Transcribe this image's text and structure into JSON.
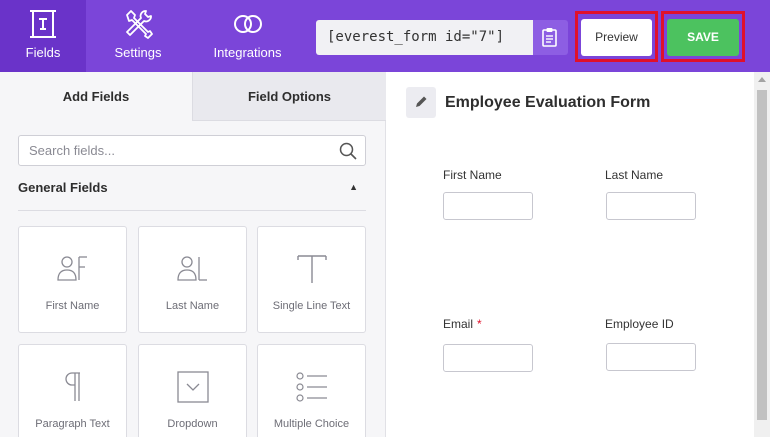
{
  "topnav": {
    "fields": {
      "label": "Fields",
      "icon": "form-fields-icon"
    },
    "settings": {
      "label": "Settings",
      "icon": "tools-icon"
    },
    "integrations": {
      "label": "Integrations",
      "icon": "rings-icon"
    }
  },
  "shortcode": "[everest_form id=\"7\"]",
  "copy_icon": "clipboard-icon",
  "actions": {
    "preview": "Preview",
    "save": "SAVE"
  },
  "colors": {
    "topbar": "#7b45d9",
    "active_nav": "#6a33c9",
    "save": "#4cc25f",
    "highlight": "#e0102b"
  },
  "left": {
    "tabs": [
      "Add Fields",
      "Field Options"
    ],
    "search_placeholder": "Search fields...",
    "section_title": "General Fields",
    "fields": [
      {
        "label": "First Name",
        "icon": "first-name-icon"
      },
      {
        "label": "Last Name",
        "icon": "last-name-icon"
      },
      {
        "label": "Single Line Text",
        "icon": "text-icon"
      },
      {
        "label": "Paragraph Text",
        "icon": "paragraph-icon"
      },
      {
        "label": "Dropdown",
        "icon": "dropdown-icon"
      },
      {
        "label": "Multiple Choice",
        "icon": "multiple-choice-icon"
      }
    ]
  },
  "form": {
    "title": "Employee Evaluation Form",
    "fields": [
      {
        "label": "First Name",
        "required": false
      },
      {
        "label": "Last Name",
        "required": false
      },
      {
        "label": "Email",
        "required": true,
        "required_mark": "*"
      },
      {
        "label": "Employee ID",
        "required": false
      }
    ]
  }
}
